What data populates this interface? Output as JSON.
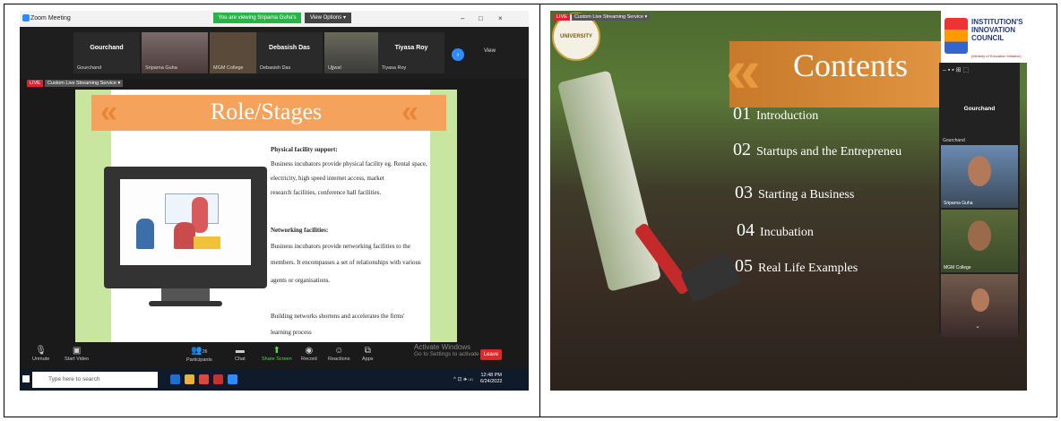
{
  "zoom": {
    "app_title": "Zoom Meeting",
    "viewing_banner": "You are viewing Sriparna Guha's screen",
    "view_options": "View Options ▾",
    "window_controls": [
      "–",
      "□",
      "×"
    ],
    "view_label": "View",
    "participants": [
      {
        "name": "Gourchand",
        "sub": "Gourchand"
      },
      {
        "name": "",
        "sub": "Sriparna Guha"
      },
      {
        "name": "",
        "sub": "MGM College"
      },
      {
        "name": "Debasish Das",
        "sub": "Debasish Das"
      },
      {
        "name": "",
        "sub": "Ujjwal"
      },
      {
        "name": "Tiyasa Roy",
        "sub": "Tiyasa Roy"
      }
    ],
    "stream": {
      "live": "LIVE",
      "service": "Custom Live Streaming Service ▾"
    },
    "toolbar": [
      {
        "icon": "mic-icon",
        "label": "Unmute"
      },
      {
        "icon": "video-icon",
        "label": "Start Video"
      },
      {
        "icon": "participants-icon",
        "label": "Participants",
        "count": "26"
      },
      {
        "icon": "chat-icon",
        "label": "Chat"
      },
      {
        "icon": "share-screen-icon",
        "label": "Share Screen"
      },
      {
        "icon": "record-icon",
        "label": "Record"
      },
      {
        "icon": "reactions-icon",
        "label": "Reactions"
      },
      {
        "icon": "apps-icon",
        "label": "Apps"
      }
    ],
    "leave_label": "Leave",
    "activate": [
      "Activate Windows",
      "Go to Settings to activate"
    ]
  },
  "slide1": {
    "title": "Role/Stages",
    "physical_heading": "Physical facility support:",
    "physical_lines": [
      "Business incubators provide physical facility eg. Rental space,",
      "electricity, high speed internet access, market",
      "research facilities, conference hall facilities."
    ],
    "networking_heading": "Networking facilities:",
    "networking_lines": [
      "Business incubators provide networking facilities to the",
      "members. It encompasses a set of relationships with various",
      "agents or organisations."
    ],
    "building_lines": [
      "Building networks shortens and accelerates the firms'",
      "learning process"
    ]
  },
  "taskbar": {
    "search_placeholder": "Type here to search",
    "time": "12:48 PM",
    "date": "6/24/2022",
    "tray": "^ ⊡ 🕪 ⑷"
  },
  "slide2": {
    "stream": {
      "live": "LIVE",
      "service": "Custom Live Streaming Service ▾"
    },
    "university": "UNIVERSITY",
    "title": "Contents",
    "items": [
      {
        "num": "01",
        "text": "Introduction"
      },
      {
        "num": "02",
        "text": "Startups and the Entrepreneu"
      },
      {
        "num": "03",
        "text": "Starting a Business"
      },
      {
        "num": "04",
        "text": "Incubation"
      },
      {
        "num": "05",
        "text": "Real Life Examples"
      }
    ],
    "iic": {
      "line1": "INSTITUTION'S",
      "line2": "INNOVATION",
      "line3": "COUNCIL",
      "sub": "(Ministry of Education Initiative)"
    },
    "panel": {
      "controls": "– ▪ ▪ ⊞ ⬚",
      "name": "Gourchand",
      "sub": "Gourchand",
      "tiles": [
        "Sriparna Guha",
        "MGM College",
        ""
      ],
      "more": "⌄"
    }
  }
}
